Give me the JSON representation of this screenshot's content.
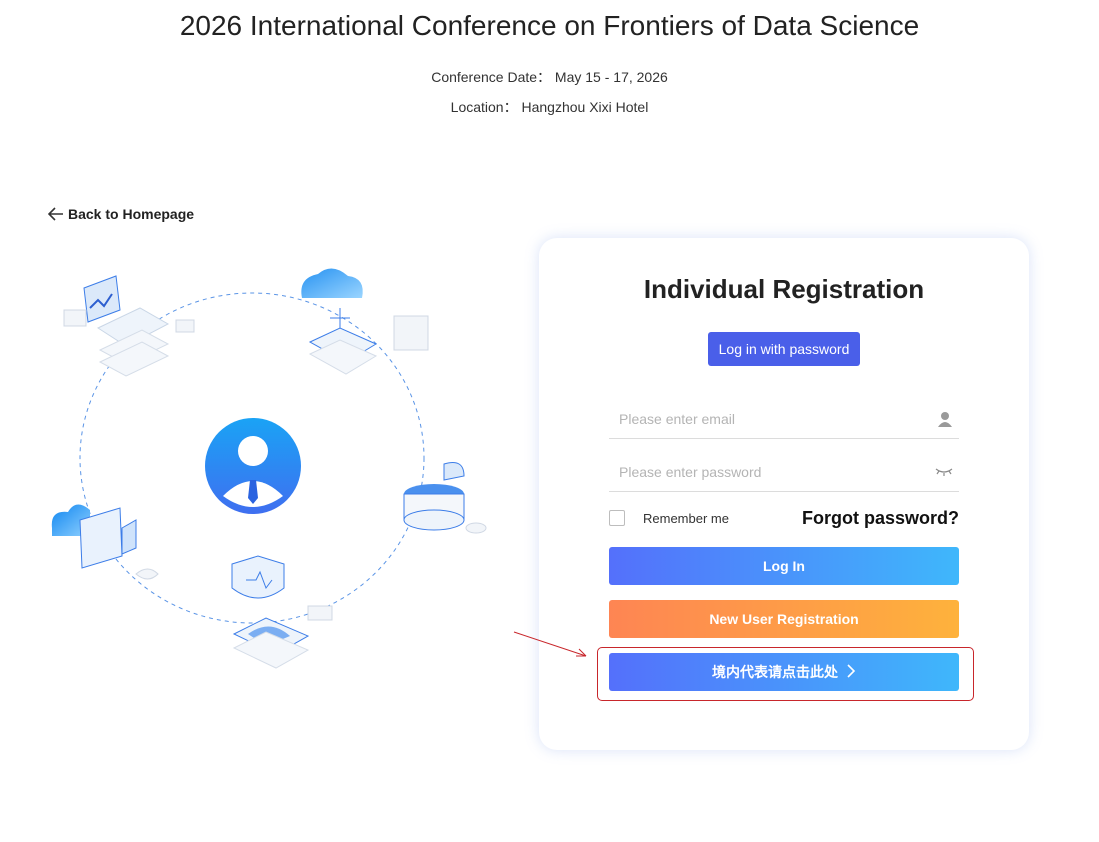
{
  "header": {
    "title": "2026 International Conference on Frontiers of Data Science",
    "conference_date": "Conference Date： May 15 - 17, 2026",
    "location": "Location： Hangzhou Xixi Hotel"
  },
  "back_link": {
    "label": "Back to Homepage",
    "icon": "arrow-left-icon"
  },
  "form": {
    "title": "Individual Registration",
    "login_tab_label": "Log in with password",
    "email_placeholder": "Please enter email",
    "email_value": "",
    "email_icon": "user-icon",
    "password_placeholder": "Please enter password",
    "password_value": "",
    "password_icon": "eye-closed-icon",
    "remember_label": "Remember me",
    "remember_checked": false,
    "forgot_label": "Forgot password?",
    "login_button": "Log In",
    "new_user_button": "New User Registration",
    "domestic_button": "境内代表请点击此处",
    "domestic_icon": "chevron-right-icon"
  },
  "colors": {
    "tab_blue": "#4a5fe9",
    "primary_gradient_start": "#5470fb",
    "primary_gradient_end": "#3fb7fb",
    "orange_gradient_start": "#fe8553",
    "orange_gradient_end": "#feb23c",
    "annotation_red": "#c8262b"
  },
  "illustration": {
    "icons": [
      "user-avatar-icon",
      "laptop-icon",
      "cloud-icon",
      "video-camera-icon",
      "shield-icon",
      "database-icon"
    ]
  }
}
